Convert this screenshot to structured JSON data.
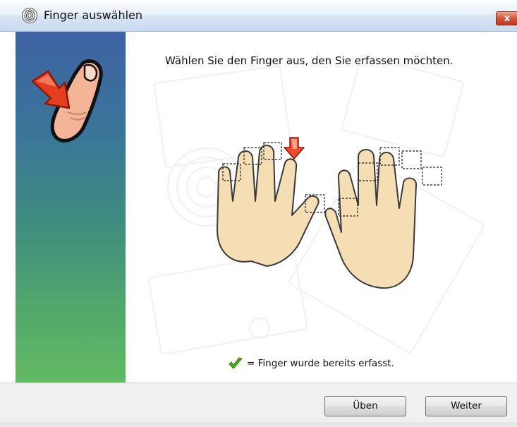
{
  "window": {
    "title": "Finger auswählen",
    "title_icon": "fingerprint-icon",
    "close_label": "x"
  },
  "sidebar": {
    "icon": "finger-select-icon",
    "gradient_colors": [
      "#3e62a4",
      "#3f8d7f",
      "#62b962"
    ]
  },
  "content": {
    "instruction": "Wählen Sie den Finger aus, den Sie erfassen möchten.",
    "selected_finger": "left-hand-index",
    "legend_icon": "checkmark-icon",
    "legend_text": "= Finger wurde bereits erfasst."
  },
  "footer": {
    "practice_label": "Üben",
    "next_label": "Weiter"
  },
  "colors": {
    "accent_red": "#e03a1e",
    "check_green": "#4caf1d"
  }
}
